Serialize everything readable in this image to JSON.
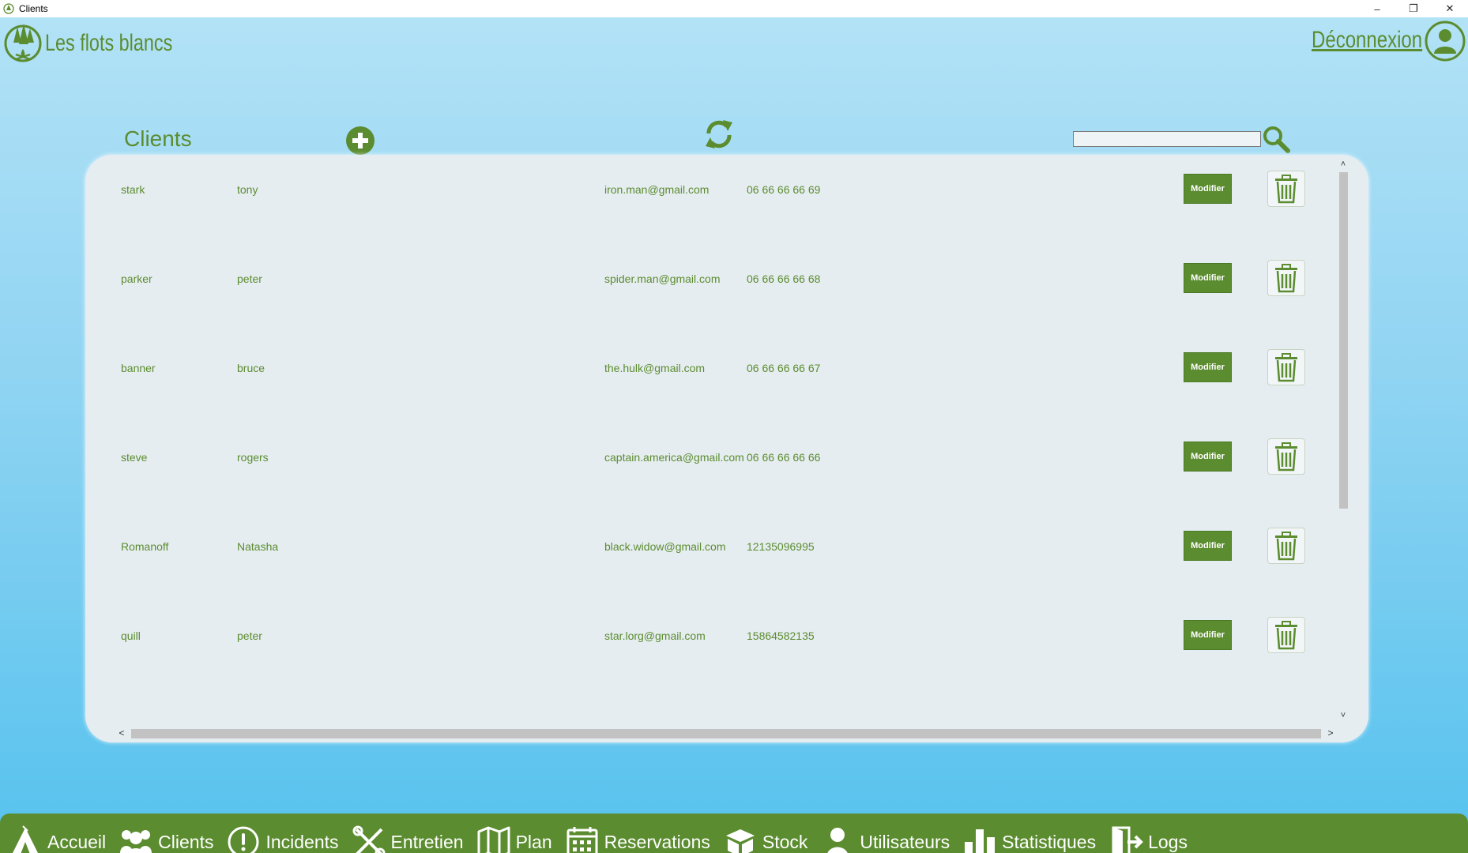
{
  "window": {
    "title": "Clients",
    "minimize": "–",
    "restore": "❐",
    "close": "✕"
  },
  "header": {
    "brand": "Les flots blancs",
    "logout": "Déconnexion"
  },
  "toolbar": {
    "title": "Clients",
    "search_value": ""
  },
  "clients": [
    {
      "nom": "stark",
      "prenom": "tony",
      "email": "iron.man@gmail.com",
      "telephone": "06 66 66 66 69"
    },
    {
      "nom": "parker",
      "prenom": "peter",
      "email": "spider.man@gmail.com",
      "telephone": "06 66 66 66 68"
    },
    {
      "nom": "banner",
      "prenom": "bruce",
      "email": "the.hulk@gmail.com",
      "telephone": "06 66 66 66 67"
    },
    {
      "nom": "steve",
      "prenom": "rogers",
      "email": "captain.america@gmail.com",
      "telephone": "06 66 66 66 66"
    },
    {
      "nom": "Romanoff",
      "prenom": "Natasha",
      "email": "black.widow@gmail.com",
      "telephone": "12135096995"
    },
    {
      "nom": "quill",
      "prenom": "peter",
      "email": "star.lorg@gmail.com",
      "telephone": "15864582135"
    }
  ],
  "row_actions": {
    "edit_label": "Modifier"
  },
  "scrollbars": {
    "up": "˄",
    "down": "˅",
    "left": "<",
    "right": ">"
  },
  "nav": [
    {
      "label": "Accueil",
      "icon": "tent-icon"
    },
    {
      "label": "Clients",
      "icon": "users-icon"
    },
    {
      "label": "Incidents",
      "icon": "alert-icon"
    },
    {
      "label": "Entretien",
      "icon": "tools-icon"
    },
    {
      "label": "Plan",
      "icon": "map-icon"
    },
    {
      "label": "Reservations",
      "icon": "calendar-icon"
    },
    {
      "label": "Stock",
      "icon": "boxes-icon"
    },
    {
      "label": "Utilisateurs",
      "icon": "user-icon"
    },
    {
      "label": "Statistiques",
      "icon": "bar-chart-icon"
    },
    {
      "label": "Logs",
      "icon": "logout-door-icon"
    }
  ],
  "colors": {
    "accent": "#5b8c2f",
    "background_top": "#b2e2f6",
    "background_bottom": "#55c2ee",
    "card": "#e6edf1"
  }
}
